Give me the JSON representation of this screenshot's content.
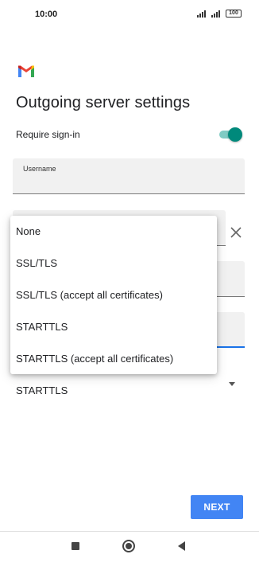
{
  "status_bar": {
    "time": "10:00",
    "battery": "100"
  },
  "header": {
    "logo_icon": "gmail-icon",
    "title": "Outgoing server settings"
  },
  "require_signin": {
    "label": "Require sign-in",
    "enabled": true,
    "accent_color": "#00897b"
  },
  "username_field": {
    "label": "Username",
    "value": ""
  },
  "security_type": {
    "selected": "STARTTLS",
    "options": [
      "None",
      "SSL/TLS",
      "SSL/TLS (accept all certificates)",
      "STARTTLS",
      "STARTTLS (accept all certificates)"
    ]
  },
  "actions": {
    "next_label": "NEXT",
    "next_color": "#4285f4"
  },
  "nav_bar": {
    "icons": [
      "recents-icon",
      "home-icon",
      "back-icon"
    ]
  }
}
